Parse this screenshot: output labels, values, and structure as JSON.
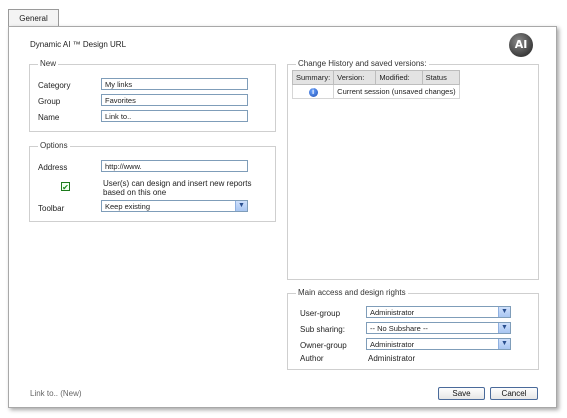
{
  "tab": {
    "label": "General"
  },
  "title": "Dynamic AI ™ Design URL",
  "logo": {
    "text": "AI"
  },
  "new_section": {
    "legend": "New",
    "category_label": "Category",
    "category_value": "My links",
    "group_label": "Group",
    "group_value": "Favorites",
    "name_label": "Name",
    "name_value": "Link to.."
  },
  "options_section": {
    "legend": "Options",
    "address_label": "Address",
    "address_value": "http://www.",
    "checkbox_checked": true,
    "checkbox_line1": "User(s) can design and insert new reports",
    "checkbox_line2": "based on this one",
    "toolbar_label": "Toolbar",
    "toolbar_value": "Keep existing"
  },
  "history_section": {
    "legend": "Change History and saved versions:",
    "headers": [
      "Summary:",
      "Version:",
      "Modified:",
      "Status"
    ],
    "rows": [
      {
        "icon": "info-icon",
        "text": "Current session (unsaved changes)"
      }
    ]
  },
  "access_section": {
    "legend": "Main access and design rights",
    "user_group_label": "User-group",
    "user_group_value": "Administrator",
    "sub_sharing_label": "Sub sharing:",
    "sub_sharing_value": "-- No Subshare --",
    "owner_group_label": "Owner-group",
    "owner_group_value": "Administrator",
    "author_label": "Author",
    "author_value": "Administrator"
  },
  "footer": {
    "status": "Link to.. (New)"
  },
  "buttons": {
    "save": "Save",
    "cancel": "Cancel"
  }
}
